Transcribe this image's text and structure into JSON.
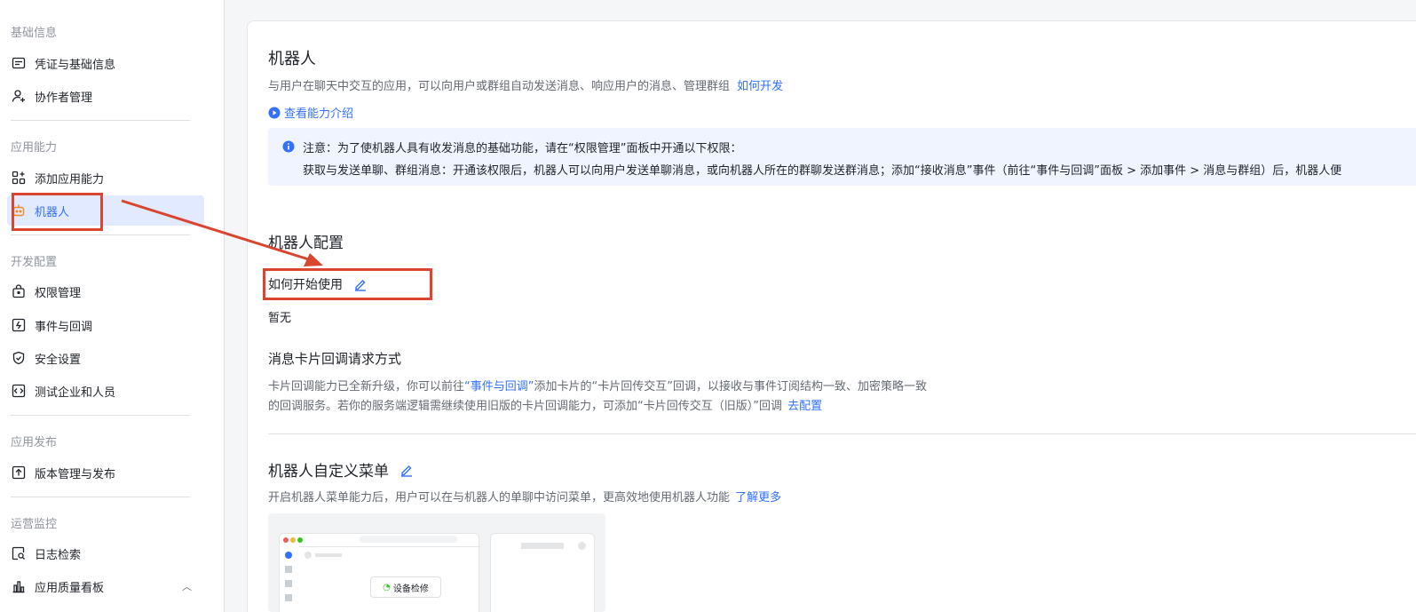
{
  "sidebar": {
    "sections": [
      {
        "title": "基础信息",
        "items": [
          {
            "label": "凭证与基础信息",
            "icon": "id-card-icon"
          },
          {
            "label": "协作者管理",
            "icon": "add-user-icon"
          }
        ]
      },
      {
        "title": "应用能力",
        "items": [
          {
            "label": "添加应用能力",
            "icon": "apps-add-icon"
          },
          {
            "label": "机器人",
            "icon": "robot-icon",
            "active": true
          }
        ]
      },
      {
        "title": "开发配置",
        "items": [
          {
            "label": "权限管理",
            "icon": "lock-bag-icon"
          },
          {
            "label": "事件与回调",
            "icon": "event-icon"
          },
          {
            "label": "安全设置",
            "icon": "shield-icon"
          },
          {
            "label": "测试企业和人员",
            "icon": "code-icon"
          }
        ]
      },
      {
        "title": "应用发布",
        "items": [
          {
            "label": "版本管理与发布",
            "icon": "upload-icon"
          }
        ]
      },
      {
        "title": "运营监控",
        "items": [
          {
            "label": "日志检索",
            "icon": "log-search-icon"
          },
          {
            "label": "应用质量看板",
            "icon": "bar-chart-icon"
          }
        ]
      }
    ]
  },
  "main": {
    "title": "机器人",
    "description": "与用户在聊天中交互的应用，可以向用户或群组自动发送消息、响应用户的消息、管理群组",
    "how_to_develop": "如何开发",
    "view_intro": "查看能力介绍",
    "notice": {
      "line1": "注意：为了使机器人具有收发消息的基础功能，请在“权限管理”面板中开通以下权限：",
      "line2": "获取与发送单聊、群组消息：开通该权限后，机器人可以向用户发送单聊消息，或向机器人所在的群聊发送群消息；添加“接收消息”事件（前往“事件与回调”面板 > 添加事件 > 消息与群组）后，机器人便"
    },
    "config_title": "机器人配置",
    "how_to_start": "如何开始使用",
    "none": "暂无",
    "card_callback_title": "消息卡片回调请求方式",
    "card_callback_desc1_pre": "卡片回调能力已全新升级，你可以前往",
    "card_callback_link": "“事件与回调”",
    "card_callback_desc1_post": "添加卡片的“卡片回传交互”回调，以接收与事件订阅结构一致、加密策略一致",
    "card_callback_desc2": "的回调服务。若你的服务端逻辑需继续使用旧版的卡片回调能力，可添加“卡片回传交互（旧版）”回调",
    "go_config": "去配置",
    "menu_title": "机器人自定义菜单",
    "menu_desc": "开启机器人菜单能力后，用户可以在与机器人的单聊中访问菜单，更高效地使用机器人功能",
    "learn_more": "了解更多",
    "preview_chip": "设备检修"
  },
  "colors": {
    "accent": "#3370ff",
    "annotation": "#d9452f"
  }
}
